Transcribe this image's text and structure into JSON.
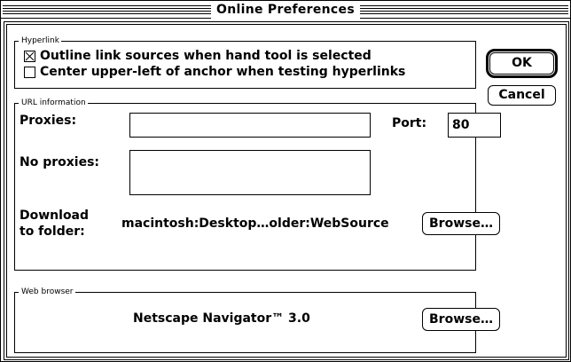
{
  "window": {
    "title": "Online Preferences"
  },
  "hyperlink": {
    "group_label": "Hyperlink",
    "outline_option": {
      "label": "Outline link sources when hand tool is selected",
      "checked": true
    },
    "center_option": {
      "label": "Center upper-left of anchor when testing hyperlinks",
      "checked": false
    }
  },
  "buttons": {
    "ok": "OK",
    "cancel": "Cancel"
  },
  "url_info": {
    "group_label": "URL information",
    "proxies_label": "Proxies:",
    "proxies_value": "",
    "port_label": "Port:",
    "port_value": "80",
    "no_proxies_label": "No proxies:",
    "no_proxies_value": "",
    "download_label_line1": "Download",
    "download_label_line2": "to folder:",
    "download_path": "macintosh:Desktop…older:WebSource",
    "browse_label": "Browse…"
  },
  "web_browser": {
    "group_label": "Web browser",
    "browser_name": "Netscape Navigator™ 3.0",
    "browse_label": "Browse…"
  }
}
